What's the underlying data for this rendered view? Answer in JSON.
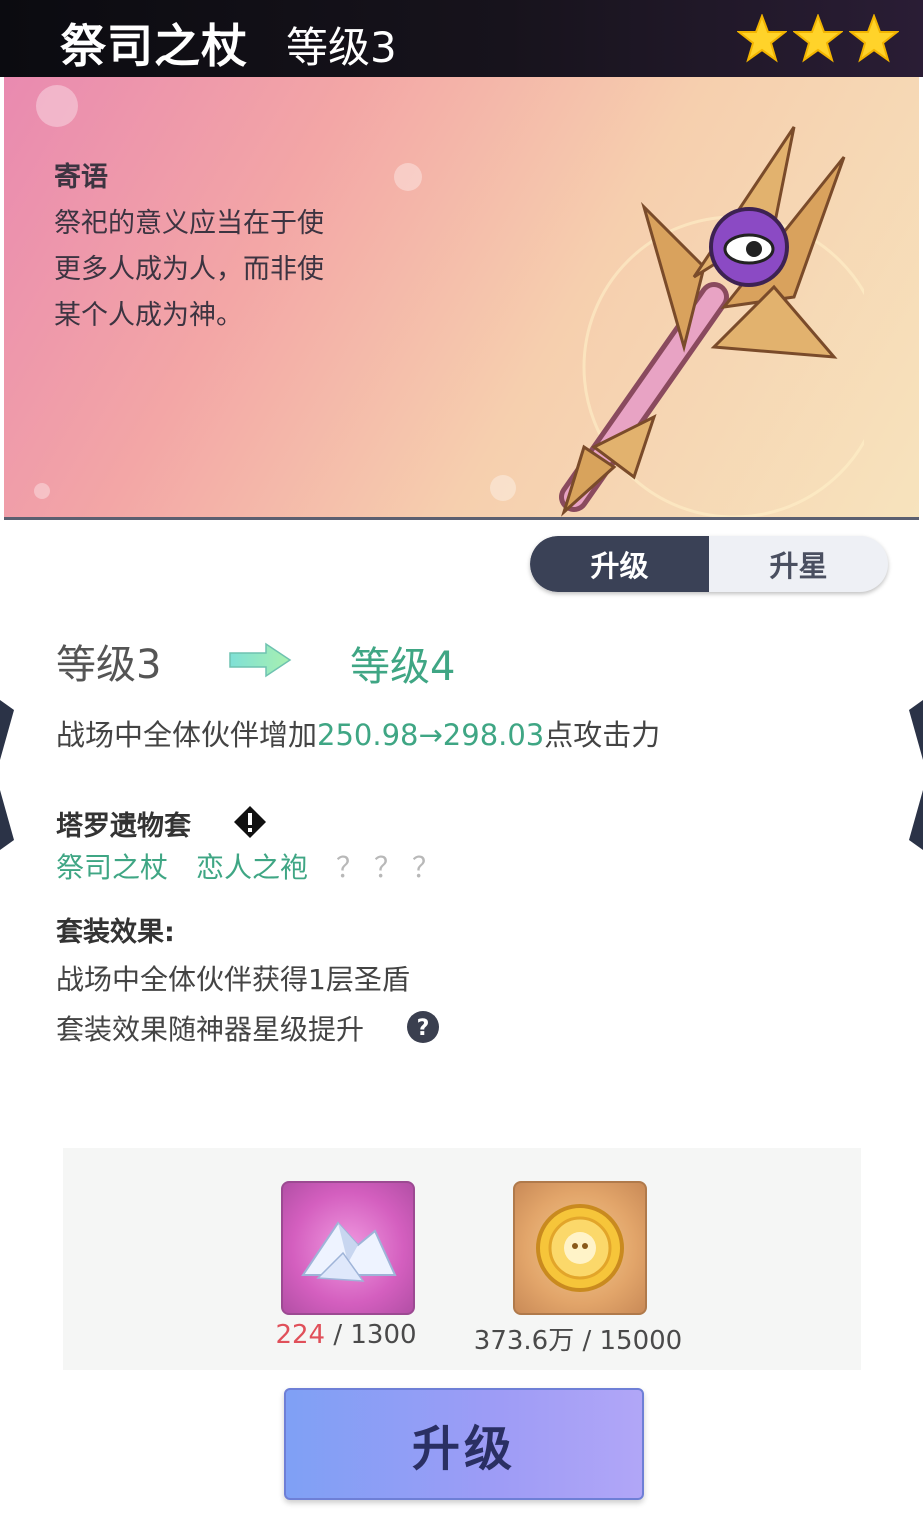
{
  "header": {
    "title": "祭司之杖",
    "level": "等级3",
    "stars": 3,
    "star_color": "#ffd32a"
  },
  "quote": {
    "title": "寄语",
    "lines": [
      "祭祀的意义应当在于使",
      "更多人成为人，而非使",
      "某个人成为神。"
    ]
  },
  "tabs": [
    {
      "label": "升级",
      "active": true
    },
    {
      "label": "升星",
      "active": false
    }
  ],
  "upgrade": {
    "from": "等级3",
    "to": "等级4",
    "stat_prefix": "战场中全体伙伴增加",
    "stat_change": "250.98→298.03",
    "stat_suffix": "点攻击力"
  },
  "set": {
    "name": "塔罗遗物套",
    "items": [
      "祭司之杖",
      "恋人之袍"
    ],
    "unknown": "？？？",
    "effect_title": "套装效果:",
    "effect": "战场中全体伙伴获得1层圣盾",
    "note": "套装效果随神器星级提升"
  },
  "materials": [
    {
      "icon": "crystal-shards-icon",
      "have": "224",
      "need": "/ 1300"
    },
    {
      "icon": "gold-coin-icon",
      "have": "373.6万",
      "need": "/ 15000"
    }
  ],
  "button": {
    "label": "升级"
  },
  "colors": {
    "accent_green": "#3fa684",
    "insufficient_red": "#e0505a",
    "tab_active": "#3a4156"
  }
}
